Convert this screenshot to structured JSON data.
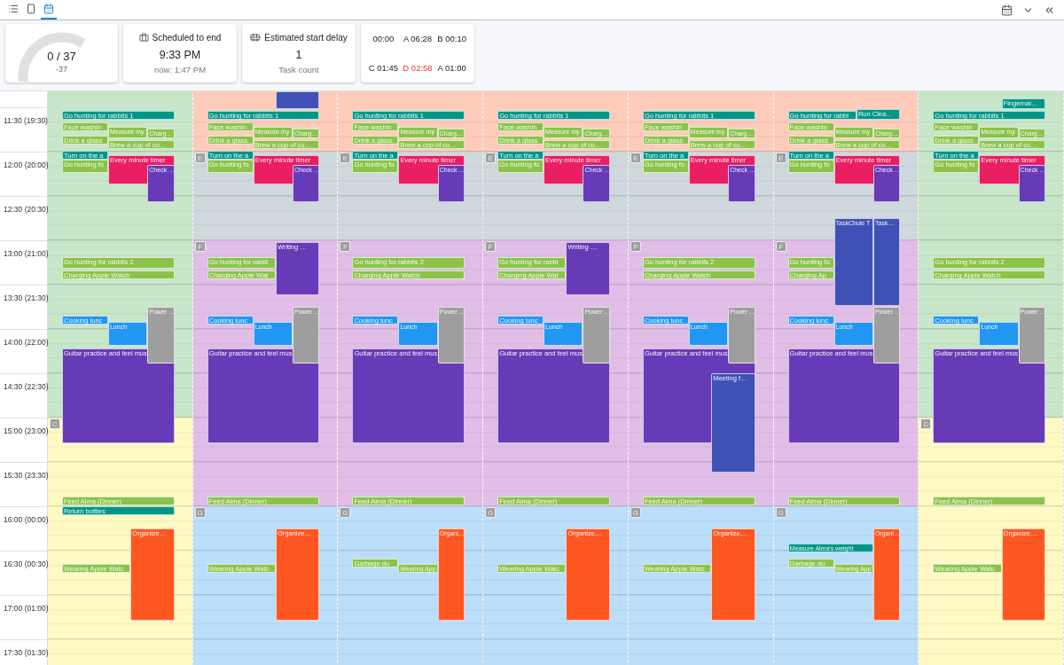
{
  "view_tabs": [
    {
      "kind": "list",
      "selected": false
    },
    {
      "kind": "phone",
      "selected": false
    },
    {
      "kind": "calendar",
      "selected": true
    }
  ],
  "progress": {
    "value": "0 / 37",
    "delta": "-37"
  },
  "scheduled_end": {
    "title": "Scheduled to end",
    "time": "9:33 PM",
    "now": "now: 1:47 PM"
  },
  "start_delay": {
    "title": "Estimated start delay",
    "value": "1",
    "caption": "Task count"
  },
  "counters": [
    {
      "text": "00:00",
      "alert": false
    },
    {
      "text": "A 06:28",
      "alert": false
    },
    {
      "text": "B 00:10",
      "alert": false
    },
    {
      "text": "C 01:45",
      "alert": false
    },
    {
      "text": "D 02:58",
      "alert": true
    },
    {
      "text": "A 01:00",
      "alert": false
    }
  ],
  "time_labels": [
    "11:30 (19:30)",
    "12:00 (20:00)",
    "12:30 (20:30)",
    "13:00 (21:00)",
    "13:30 (21:30)",
    "14:00 (22:00)",
    "14:30 (22:30)",
    "15:00 (23:00)",
    "15:30 (23:30)",
    "16:00 (00:00)",
    "16:30 (00:30)",
    "17:00 (01:00)",
    "17:30 (01:30)"
  ],
  "days": [
    {
      "bands": [
        {
          "color": "#c8e6c9"
        },
        {
          "marker": "C",
          "color": "#fff9c4"
        }
      ],
      "events": [
        {
          "title": "Go hunting for rabbits 1",
          "color": "#009688"
        },
        {
          "title": "Face washin",
          "color": "#8bc34a"
        },
        {
          "title": "Drink a glass",
          "color": "#8bc34a"
        },
        {
          "title": "Measure my",
          "color": "#8bc34a"
        },
        {
          "title": "Charg…",
          "color": "#8bc34a"
        },
        {
          "title": "Brew a cup of co…",
          "color": "#8bc34a"
        },
        {
          "title": "Turn on the a",
          "color": "#009688"
        },
        {
          "title": "Go hunting fo",
          "color": "#8bc34a"
        },
        {
          "title": "Every minute timer",
          "color": "#e91e63"
        },
        {
          "title": "Check …",
          "color": "#673ab7"
        },
        {
          "title": "Go hunting for rabbits 2",
          "color": "#8bc34a"
        },
        {
          "title": "Charging Apple Watch",
          "color": "#8bc34a"
        },
        {
          "title": "Cooking lunc",
          "color": "#2196f3"
        },
        {
          "title": "Guitar practice and feel mus",
          "color": "#673ab7"
        },
        {
          "title": "Lunch",
          "color": "#2196f3"
        },
        {
          "title": "Power …",
          "color": "#9e9e9e"
        },
        {
          "title": "Feed Alma (Dinner)",
          "color": "#8bc34a"
        },
        {
          "title": "Return bottles",
          "color": "#009688"
        },
        {
          "title": "Wearing Apple Watc",
          "color": "#8bc34a"
        },
        {
          "title": "Organize…",
          "color": "#ff5722"
        }
      ]
    },
    {
      "bands": [
        {
          "color": "#ffccbc"
        },
        {
          "marker": "E",
          "color": "#cfd8dc"
        },
        {
          "marker": "F",
          "color": "#e1bee7"
        },
        {
          "marker": "G",
          "color": "#bbdefb"
        }
      ],
      "events": [
        {
          "color": "#3f51b5"
        },
        {
          "title": "Go hunting for rabbits 1",
          "color": "#009688"
        },
        {
          "title": "Face washin",
          "color": "#8bc34a"
        },
        {
          "title": "Drink a glass",
          "color": "#8bc34a"
        },
        {
          "title": "Measure my",
          "color": "#8bc34a"
        },
        {
          "title": "Charg…",
          "color": "#8bc34a"
        },
        {
          "title": "Brew a cup of co…",
          "color": "#8bc34a"
        },
        {
          "title": "Turn on the a",
          "color": "#009688"
        },
        {
          "title": "Go hunting fo",
          "color": "#8bc34a"
        },
        {
          "title": "Every minute timer",
          "color": "#e91e63"
        },
        {
          "title": "Check …",
          "color": "#673ab7"
        },
        {
          "title": "Go hunting for rabbi",
          "color": "#8bc34a"
        },
        {
          "title": "Charging Apple Wat",
          "color": "#8bc34a"
        },
        {
          "title": "Writing …",
          "color": "#673ab7"
        },
        {
          "title": "Cooking lunc",
          "color": "#2196f3"
        },
        {
          "title": "Guitar practice and feel mus",
          "color": "#673ab7"
        },
        {
          "title": "Lunch",
          "color": "#2196f3"
        },
        {
          "title": "Power …",
          "color": "#9e9e9e"
        },
        {
          "title": "Feed Alma (Dinner)",
          "color": "#8bc34a"
        },
        {
          "title": "Wearing Apple Watc",
          "color": "#8bc34a"
        },
        {
          "title": "Organize…",
          "color": "#ff5722"
        }
      ]
    },
    {
      "bands": [
        {
          "color": "#ffccbc"
        },
        {
          "marker": "E",
          "color": "#cfd8dc"
        },
        {
          "marker": "F",
          "color": "#e1bee7"
        },
        {
          "marker": "G",
          "color": "#bbdefb"
        }
      ],
      "events": [
        {
          "title": "Go hunting for rabbits 1",
          "color": "#009688"
        },
        {
          "title": "Face washin",
          "color": "#8bc34a"
        },
        {
          "title": "Drink a glass",
          "color": "#8bc34a"
        },
        {
          "title": "Measure my",
          "color": "#8bc34a"
        },
        {
          "title": "Charg…",
          "color": "#8bc34a"
        },
        {
          "title": "Brew a cup of co…",
          "color": "#8bc34a"
        },
        {
          "title": "Turn on the a",
          "color": "#009688"
        },
        {
          "title": "Go hunting fo",
          "color": "#8bc34a"
        },
        {
          "title": "Every minute timer",
          "color": "#e91e63"
        },
        {
          "title": "Check …",
          "color": "#673ab7"
        },
        {
          "title": "Go hunting for rabbits 2",
          "color": "#8bc34a"
        },
        {
          "title": "Charging Apple Watch",
          "color": "#8bc34a"
        },
        {
          "title": "Cooking lunc",
          "color": "#2196f3"
        },
        {
          "title": "Guitar practice and feel mus",
          "color": "#673ab7"
        },
        {
          "title": "Lunch",
          "color": "#2196f3"
        },
        {
          "title": "Power …",
          "color": "#9e9e9e"
        },
        {
          "title": "Feed Alma (Dinner)",
          "color": "#8bc34a"
        },
        {
          "title": "Garbage du",
          "color": "#8bc34a"
        },
        {
          "title": "Wearing App",
          "color": "#8bc34a"
        },
        {
          "title": "Organi…",
          "color": "#ff5722"
        }
      ]
    },
    {
      "bands": [
        {
          "color": "#ffccbc"
        },
        {
          "marker": "E",
          "color": "#cfd8dc"
        },
        {
          "marker": "F",
          "color": "#e1bee7"
        },
        {
          "marker": "G",
          "color": "#bbdefb"
        }
      ],
      "events": [
        {
          "title": "Go hunting for rabbits 1",
          "color": "#009688"
        },
        {
          "title": "Face washin",
          "color": "#8bc34a"
        },
        {
          "title": "Drink a glass",
          "color": "#8bc34a"
        },
        {
          "title": "Measure my",
          "color": "#8bc34a"
        },
        {
          "title": "Charg…",
          "color": "#8bc34a"
        },
        {
          "title": "Brew a cup of co…",
          "color": "#8bc34a"
        },
        {
          "title": "Turn on the a",
          "color": "#009688"
        },
        {
          "title": "Go hunting fo",
          "color": "#8bc34a"
        },
        {
          "title": "Every minute timer",
          "color": "#e91e63"
        },
        {
          "title": "Check …",
          "color": "#673ab7"
        },
        {
          "title": "Go hunting for rabbi",
          "color": "#8bc34a"
        },
        {
          "title": "Charging Apple Wat",
          "color": "#8bc34a"
        },
        {
          "title": "Writing …",
          "color": "#673ab7"
        },
        {
          "title": "Cooking lunc",
          "color": "#2196f3"
        },
        {
          "title": "Guitar practice and feel mus",
          "color": "#673ab7"
        },
        {
          "title": "Lunch",
          "color": "#2196f3"
        },
        {
          "title": "Power …",
          "color": "#9e9e9e"
        },
        {
          "title": "Feed Alma (Dinner)",
          "color": "#8bc34a"
        },
        {
          "title": "Wearing Apple Watc",
          "color": "#8bc34a"
        },
        {
          "title": "Organize…",
          "color": "#ff5722"
        }
      ]
    },
    {
      "bands": [
        {
          "color": "#ffccbc"
        },
        {
          "marker": "E",
          "color": "#cfd8dc"
        },
        {
          "marker": "F",
          "color": "#e1bee7"
        },
        {
          "marker": "G",
          "color": "#bbdefb"
        }
      ],
      "events": [
        {
          "title": "Go hunting for rabbits 1",
          "color": "#009688"
        },
        {
          "title": "Face washin",
          "color": "#8bc34a"
        },
        {
          "title": "Drink a glass",
          "color": "#8bc34a"
        },
        {
          "title": "Measure my",
          "color": "#8bc34a"
        },
        {
          "title": "Charg…",
          "color": "#8bc34a"
        },
        {
          "title": "Brew a cup of co…",
          "color": "#8bc34a"
        },
        {
          "title": "Turn on the a",
          "color": "#009688"
        },
        {
          "title": "Go hunting fo",
          "color": "#8bc34a"
        },
        {
          "title": "Every minute timer",
          "color": "#e91e63"
        },
        {
          "title": "Check …",
          "color": "#673ab7"
        },
        {
          "title": "Go hunting for rabbits 2",
          "color": "#8bc34a"
        },
        {
          "title": "Charging Apple Watch",
          "color": "#8bc34a"
        },
        {
          "title": "Cooking lunc",
          "color": "#2196f3"
        },
        {
          "title": "Guitar practice and feel mus",
          "color": "#673ab7"
        },
        {
          "title": "Lunch",
          "color": "#2196f3"
        },
        {
          "title": "Power …",
          "color": "#9e9e9e"
        },
        {
          "title": "Meeting f…",
          "color": "#3f51b5"
        },
        {
          "title": "Feed Alma (Dinner)",
          "color": "#8bc34a"
        },
        {
          "title": "Wearing Apple Watc",
          "color": "#8bc34a"
        },
        {
          "title": "Organize…",
          "color": "#ff5722"
        }
      ]
    },
    {
      "bands": [
        {
          "color": "#ffccbc"
        },
        {
          "marker": "E",
          "color": "#cfd8dc"
        },
        {
          "marker": "F",
          "color": "#e1bee7"
        },
        {
          "marker": "G",
          "color": "#bbdefb"
        }
      ],
      "events": [
        {
          "title": "Go hunting for rabbi",
          "color": "#009688"
        },
        {
          "title": "Run Clea…",
          "color": "#009688"
        },
        {
          "title": "Face washin",
          "color": "#8bc34a"
        },
        {
          "title": "Drink a glass",
          "color": "#8bc34a"
        },
        {
          "title": "Measure my",
          "color": "#8bc34a"
        },
        {
          "title": "Charg…",
          "color": "#8bc34a"
        },
        {
          "title": "Brew a cup of co…",
          "color": "#8bc34a"
        },
        {
          "title": "Turn on the a",
          "color": "#009688"
        },
        {
          "title": "Go hunting fo",
          "color": "#8bc34a"
        },
        {
          "title": "Every minute timer",
          "color": "#e91e63"
        },
        {
          "title": "Check …",
          "color": "#673ab7"
        },
        {
          "title": "TaskChule T",
          "color": "#3f51b5"
        },
        {
          "title": "Task…",
          "color": "#3f51b5"
        },
        {
          "title": "Go hunting fo",
          "color": "#8bc34a"
        },
        {
          "title": "Charging Ap",
          "color": "#8bc34a"
        },
        {
          "title": "Cooking lunc",
          "color": "#2196f3"
        },
        {
          "title": "Guitar practice and feel mus",
          "color": "#673ab7"
        },
        {
          "title": "Lunch",
          "color": "#2196f3"
        },
        {
          "title": "Power …",
          "color": "#9e9e9e"
        },
        {
          "title": "Feed Alma (Dinner)",
          "color": "#8bc34a"
        },
        {
          "title": "Measure Alma's weight",
          "color": "#009688"
        },
        {
          "title": "Garbage du",
          "color": "#8bc34a"
        },
        {
          "title": "Wearing App",
          "color": "#8bc34a"
        },
        {
          "title": "Organi…",
          "color": "#ff5722"
        }
      ]
    },
    {
      "bands": [
        {
          "color": "#c8e6c9"
        },
        {
          "marker": "C",
          "color": "#fff9c4"
        }
      ],
      "events": [
        {
          "title": "Go hunting for rabbits 1",
          "color": "#009688"
        },
        {
          "title": "Fingernai…",
          "color": "#009688"
        },
        {
          "title": "Face washin",
          "color": "#8bc34a"
        },
        {
          "title": "Drink a glass",
          "color": "#8bc34a"
        },
        {
          "title": "Measure my",
          "color": "#8bc34a"
        },
        {
          "title": "Charg…",
          "color": "#8bc34a"
        },
        {
          "title": "Brew a cup of co…",
          "color": "#8bc34a"
        },
        {
          "title": "Turn on the a",
          "color": "#009688"
        },
        {
          "title": "Go hunting fo",
          "color": "#8bc34a"
        },
        {
          "title": "Every minute timer",
          "color": "#e91e63"
        },
        {
          "title": "Check …",
          "color": "#673ab7"
        },
        {
          "title": "Go hunting for rabbits 2",
          "color": "#8bc34a"
        },
        {
          "title": "Charging Apple Watch",
          "color": "#8bc34a"
        },
        {
          "title": "Cooking lunc",
          "color": "#2196f3"
        },
        {
          "title": "Guitar practice and feel mus",
          "color": "#673ab7"
        },
        {
          "title": "Lunch",
          "color": "#2196f3"
        },
        {
          "title": "Power …",
          "color": "#9e9e9e"
        },
        {
          "title": "Feed Alma (Dinner)",
          "color": "#8bc34a"
        },
        {
          "title": "Wearing Apple Watc",
          "color": "#8bc34a"
        },
        {
          "title": "Organize…",
          "color": "#ff5722"
        }
      ]
    }
  ]
}
